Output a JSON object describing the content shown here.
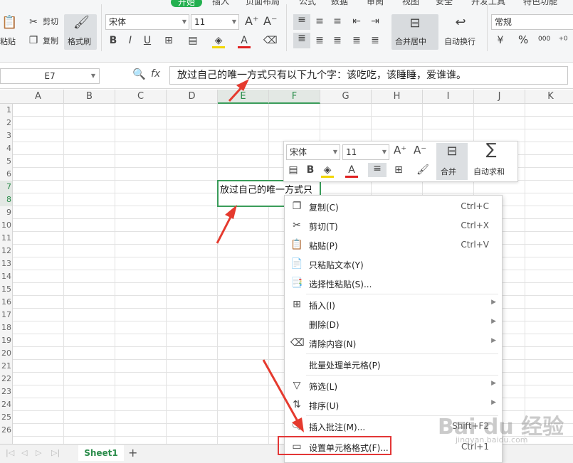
{
  "ribbon": {
    "tabs": [
      "开始",
      "插入",
      "页面布局",
      "公式",
      "数据",
      "审阅",
      "视图",
      "安全",
      "开发工具",
      "特色功能"
    ],
    "active_tab": "开始",
    "paste_label": "粘贴",
    "cut_label": "剪切",
    "copy_label": "复制",
    "format_painter_label": "格式刷",
    "font_name": "宋体",
    "font_size": "11",
    "merge_center_label": "合并居中",
    "wrap_text_label": "自动换行",
    "number_format": "常规",
    "percent": "%",
    "thousands": "000"
  },
  "formula_bar": {
    "name_box": "E7",
    "fx": "fx",
    "content": "放过自己的唯一方式只有以下九个字：该吃吃，该睡睡，爱谁谁。"
  },
  "columns": [
    "A",
    "B",
    "C",
    "D",
    "E",
    "F",
    "G",
    "H",
    "I",
    "J",
    "K"
  ],
  "rows": [
    "1",
    "2",
    "3",
    "4",
    "5",
    "6",
    "7",
    "8",
    "9",
    "10",
    "11",
    "12",
    "13",
    "14",
    "15",
    "16",
    "17",
    "18",
    "19",
    "20",
    "21",
    "22",
    "23",
    "24",
    "25",
    "26"
  ],
  "cell_text": "放过自己的唯一方式只",
  "mini_toolbar": {
    "font_name": "宋体",
    "font_size": "11",
    "merge_label": "合并",
    "autosum_label": "自动求和"
  },
  "context_menu": {
    "items": [
      {
        "label": "复制(C)",
        "shortcut": "Ctrl+C"
      },
      {
        "label": "剪切(T)",
        "shortcut": "Ctrl+X"
      },
      {
        "label": "粘贴(P)",
        "shortcut": "Ctrl+V"
      },
      {
        "label": "只粘贴文本(Y)",
        "shortcut": ""
      },
      {
        "label": "选择性粘贴(S)...",
        "shortcut": ""
      },
      {
        "label": "插入(I)",
        "shortcut": ""
      },
      {
        "label": "删除(D)",
        "shortcut": ""
      },
      {
        "label": "清除内容(N)",
        "shortcut": ""
      },
      {
        "label": "批量处理单元格(P)",
        "shortcut": ""
      },
      {
        "label": "筛选(L)",
        "shortcut": ""
      },
      {
        "label": "排序(U)",
        "shortcut": ""
      },
      {
        "label": "插入批注(M)...",
        "shortcut": "Shift+F2"
      },
      {
        "label": "设置单元格格式(F)...",
        "shortcut": "Ctrl+1"
      }
    ]
  },
  "sheet_tab": "Sheet1",
  "add_sheet": "+",
  "watermark": "Bai du 经验",
  "watermark_url": "jingyan.baidu.com"
}
